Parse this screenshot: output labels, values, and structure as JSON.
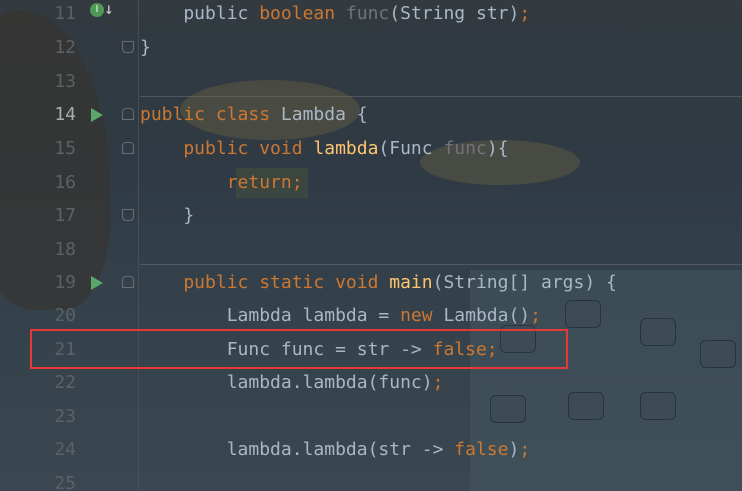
{
  "editor": {
    "lines": [
      {
        "num": "11",
        "t1": "    public ",
        "t2": "boolean",
        "t3": " ",
        "t4": "func",
        "t5": "(String str)",
        "t6": ";"
      },
      {
        "num": "12",
        "text": "}"
      },
      {
        "num": "13",
        "text": ""
      },
      {
        "num": "14",
        "t1": "public class ",
        "t2": "Lambda",
        "t3": " {"
      },
      {
        "num": "15",
        "t1": "    public void ",
        "t2": "lambda",
        "t3": "(Func ",
        "t4": "func",
        "t5": "){"
      },
      {
        "num": "16",
        "t1": "        ",
        "t2": "return;"
      },
      {
        "num": "17",
        "text": "    }"
      },
      {
        "num": "18",
        "text": ""
      },
      {
        "num": "19",
        "t1": "    public static void ",
        "t2": "main",
        "t3": "(String[] args) {"
      },
      {
        "num": "20",
        "t1": "        Lambda lambda = ",
        "t2": "new",
        "t3": " Lambda()",
        "t4": ";"
      },
      {
        "num": "21",
        "t1": "        Func func = str -> ",
        "t2": "false",
        "t3": ";"
      },
      {
        "num": "22",
        "t1": "        lambda.lambda(func)",
        "t2": ";"
      },
      {
        "num": "23",
        "text": ""
      },
      {
        "num": "24",
        "t1": "        lambda.lambda(str -> ",
        "t2": "false",
        "t3": ")",
        "t4": ";"
      },
      {
        "num": "25",
        "text": ""
      }
    ]
  },
  "colors": {
    "keyword": "#cc7832",
    "method": "#ffc66d",
    "text": "#a9b7c6",
    "unused_param": "#72737a",
    "highlight_box": "#e53935"
  },
  "icons": {
    "run": "run-gutter-icon",
    "fold": "fold-marker-icon",
    "implemented": "implemented-method-icon"
  }
}
